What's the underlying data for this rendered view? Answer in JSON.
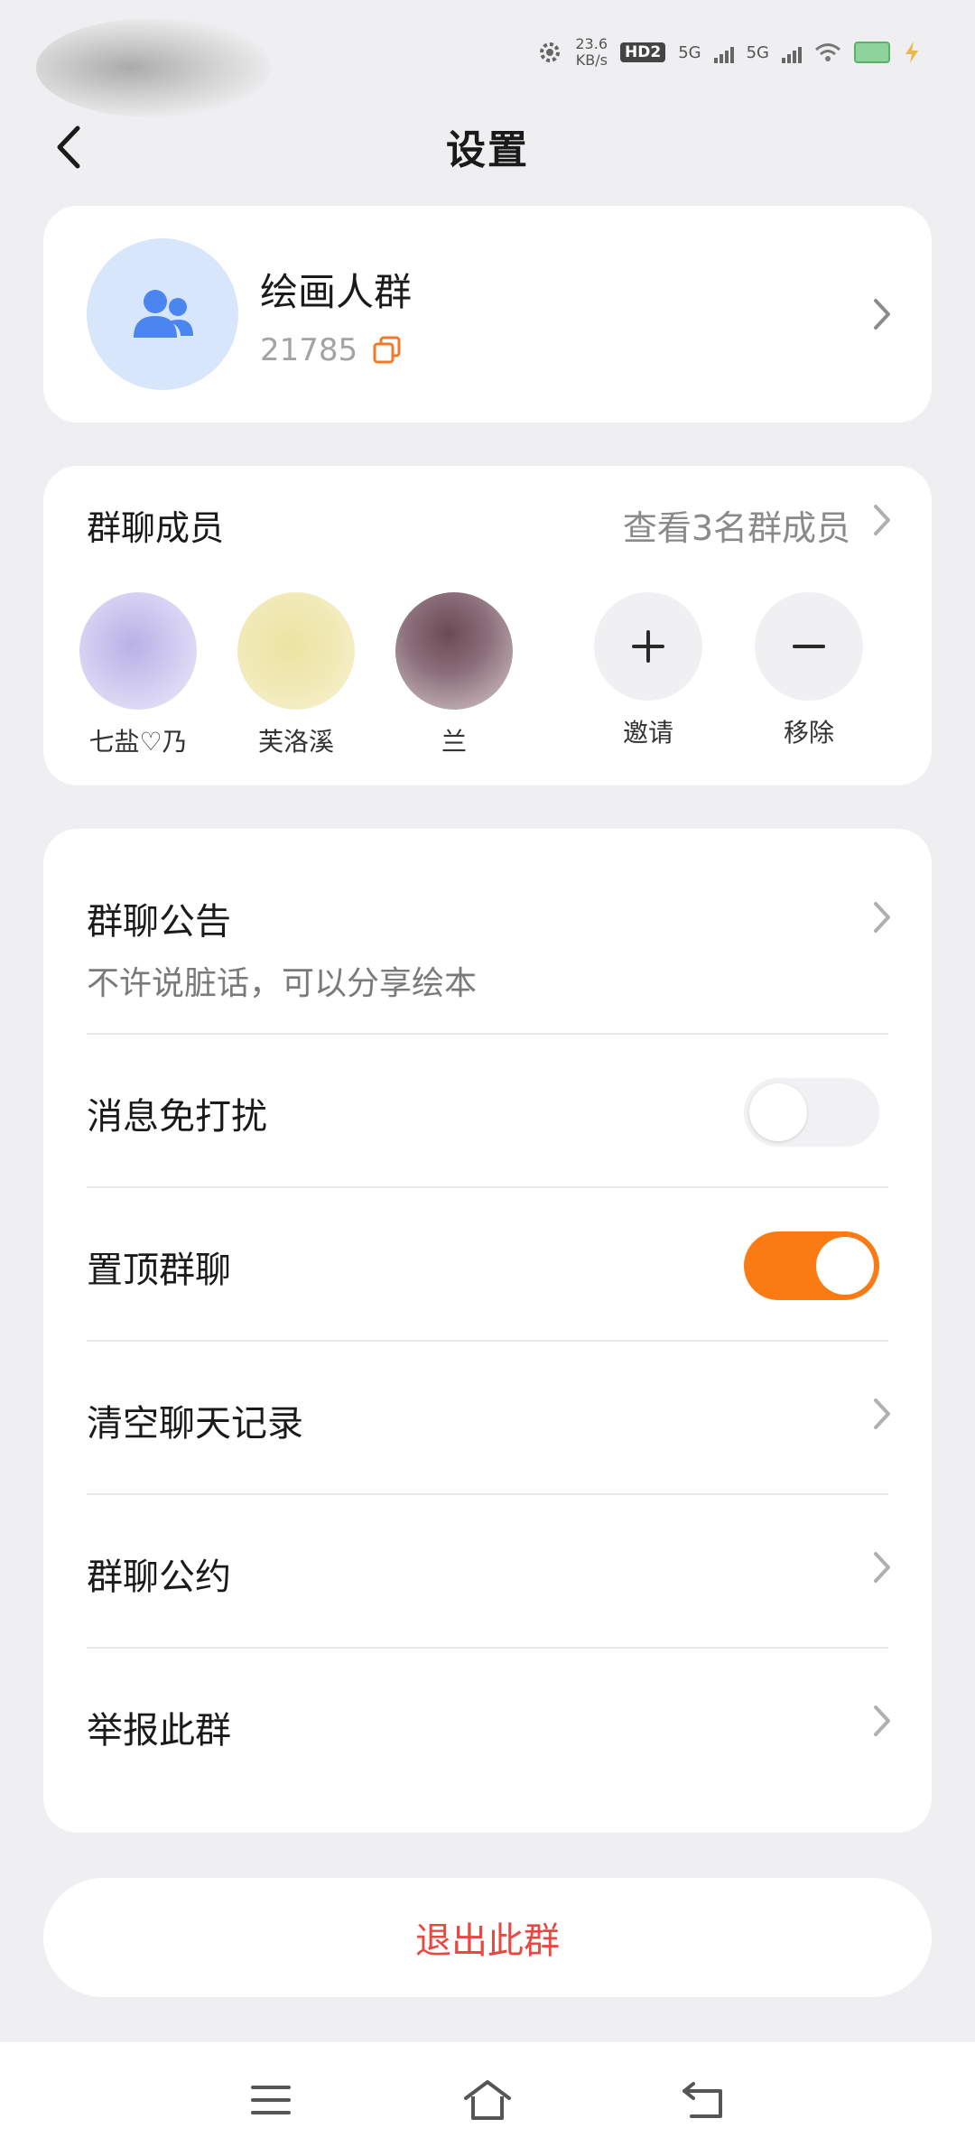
{
  "status_bar": {
    "net_speed_value": "23.6",
    "net_speed_unit": "KB/s",
    "hd_label": "HD",
    "hd_sub": "2",
    "sim1_label": "5G",
    "sim2_label": "5G"
  },
  "header": {
    "title": "设置",
    "back_icon": "chevron-left-icon"
  },
  "group": {
    "name": "绘画人群",
    "id": "21785",
    "avatar_icon": "group-people-icon",
    "copy_icon": "copy-icon",
    "accent_color": "#4b86f0",
    "copy_color": "#f07a28"
  },
  "members": {
    "title": "群聊成员",
    "view_all": "查看3名群成员",
    "list": [
      {
        "name": "七盐♡乃",
        "color": "#b9b0e6"
      },
      {
        "name": "芙洛溪",
        "color": "#ece3a2"
      },
      {
        "name": "兰",
        "color": "#8a6e79"
      }
    ],
    "invite_label": "邀请",
    "remove_label": "移除"
  },
  "settings": {
    "announcement_label": "群聊公告",
    "announcement_text": "不许说脏话，可以分享绘本",
    "mute_label": "消息免打扰",
    "mute_on": false,
    "pin_label": "置顶群聊",
    "pin_on": true,
    "clear_label": "清空聊天记录",
    "rules_label": "群聊公约",
    "report_label": "举报此群",
    "toggle_on_color": "#fa7b14"
  },
  "exit_label": "退出此群",
  "exit_color": "#e54a42",
  "nav": {
    "menu_icon": "menu-icon",
    "home_icon": "home-icon",
    "back_icon": "back-arrow-icon"
  }
}
